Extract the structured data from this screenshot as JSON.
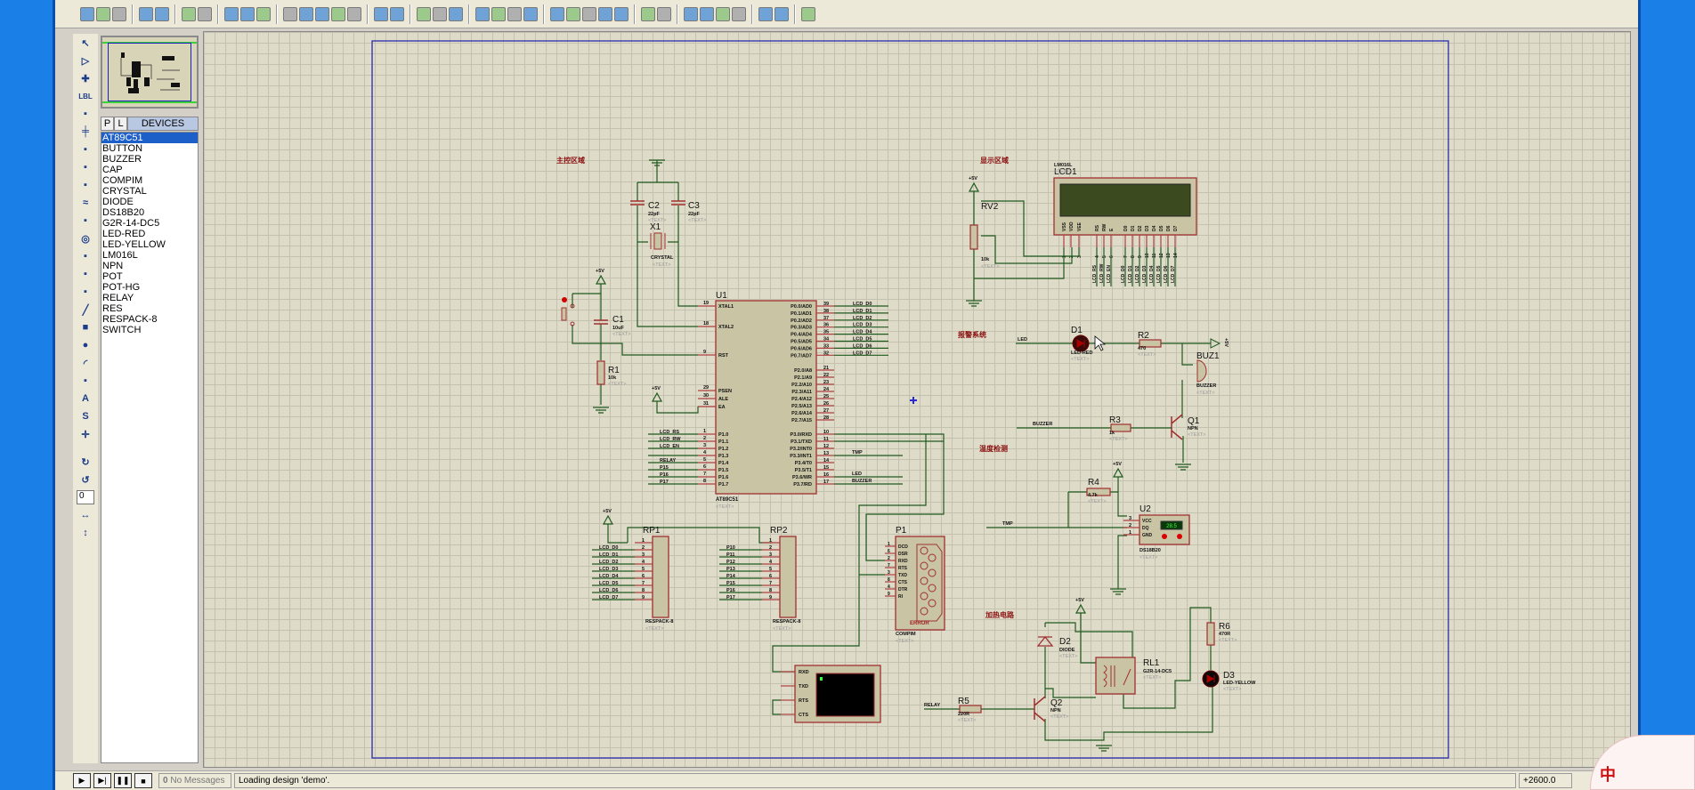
{
  "toolbar": {
    "icons": [
      "new-icon",
      "open-icon",
      "save-icon",
      "import-icon",
      "export-icon",
      "print-icon",
      "mark-area-icon",
      "refresh-icon",
      "grid-icon",
      "origin-icon",
      "pan-icon",
      "zoom-in-icon",
      "zoom-out-icon",
      "zoom-all-icon",
      "zoom-area-icon",
      "undo-icon",
      "redo-icon",
      "cut-icon",
      "copy-icon",
      "paste-icon",
      "block-copy-icon",
      "block-move-icon",
      "block-rotate-icon",
      "block-delete-icon",
      "pick-device-icon",
      "make-device-icon",
      "packaging-icon",
      "decompose-icon",
      "wire-autorouter-icon",
      "search-icon",
      "property-assign-icon",
      "new-sheet-icon",
      "add-sheet-icon",
      "remove-sheet-icon",
      "exit-to-parent-icon",
      "bill-of-materials-icon",
      "electrical-rule-check-icon",
      "ares-icon"
    ]
  },
  "tools": {
    "icons": [
      "selection-icon",
      "component-icon",
      "junction-icon",
      "wire-label-icon",
      "text-script-icon",
      "bus-icon",
      "subcircuit-icon",
      "terminal-icon",
      "device-pin-icon",
      "graph-icon",
      "tape-recorder-icon",
      "generator-icon",
      "voltage-probe-icon",
      "current-probe-icon",
      "virtual-instrument-icon",
      "line-icon",
      "box-icon",
      "circle-icon",
      "arc-icon",
      "path-icon",
      "text-icon",
      "symbol-icon",
      "marker-icon"
    ],
    "wire_label": "LBL",
    "rotation_value": "0"
  },
  "devices": {
    "tab_p": "P",
    "tab_l": "L",
    "title": "DEVICES",
    "items": [
      "AT89C51",
      "BUTTON",
      "BUZZER",
      "CAP",
      "COMPIM",
      "CRYSTAL",
      "DIODE",
      "DS18B20",
      "G2R-14-DC5",
      "LED-RED",
      "LED-YELLOW",
      "LM016L",
      "NPN",
      "POT",
      "POT-HG",
      "RELAY",
      "RES",
      "RESPACK-8",
      "SWITCH"
    ],
    "selected": "AT89C51"
  },
  "schematic": {
    "regions": [
      "主控区域",
      "显示区域",
      "报警系统",
      "温度检测",
      "加热电路"
    ],
    "text_placeholder": "<TEXT>",
    "power": "+5V",
    "components": {
      "U1": {
        "ref": "U1",
        "value": "AT89C51"
      },
      "C1": {
        "ref": "C1",
        "value": "10uF"
      },
      "C2": {
        "ref": "C2",
        "value": "22pF"
      },
      "C3": {
        "ref": "C3",
        "value": "22pF"
      },
      "X1": {
        "ref": "X1",
        "value": "CRYSTAL"
      },
      "R1": {
        "ref": "R1",
        "value": "10k"
      },
      "LCD1": {
        "ref": "LCD1",
        "value": "LM016L"
      },
      "RV2": {
        "ref": "RV2",
        "value": "10k"
      },
      "D1": {
        "ref": "D1",
        "value": "LED-RED"
      },
      "R2": {
        "ref": "R2",
        "value": "470"
      },
      "BUZ1": {
        "ref": "BUZ1",
        "value": "BUZZER"
      },
      "Q1": {
        "ref": "Q1",
        "value": "NPN"
      },
      "R3": {
        "ref": "R3",
        "value": "1k"
      },
      "R4": {
        "ref": "R4",
        "value": "4.7k"
      },
      "U2": {
        "ref": "U2",
        "value": "DS18B20",
        "display": "28.5"
      },
      "RP1": {
        "ref": "RP1",
        "value": "RESPACK-8"
      },
      "RP2": {
        "ref": "RP2",
        "value": "RESPACK-8"
      },
      "P1": {
        "ref": "P1",
        "value": "COMPIM",
        "error": "ERROR"
      },
      "D2": {
        "ref": "D2",
        "value": "DIODE"
      },
      "RL1": {
        "ref": "RL1",
        "value": "G2R-14-DC5"
      },
      "Q2": {
        "ref": "Q2",
        "value": "NPN"
      },
      "R5": {
        "ref": "R5",
        "value": "220R"
      },
      "R6": {
        "ref": "R6",
        "value": "470R"
      },
      "D3": {
        "ref": "D3",
        "value": "LED-YELLOW"
      }
    },
    "u1_left_pins": [
      {
        "num": "19",
        "name": "XTAL1"
      },
      {
        "num": "18",
        "name": "XTAL2"
      },
      {
        "num": "9",
        "name": "RST"
      },
      {
        "num": "29",
        "name": "PSEN"
      },
      {
        "num": "30",
        "name": "ALE"
      },
      {
        "num": "31",
        "name": "EA"
      },
      {
        "num": "1",
        "name": "P1.0"
      },
      {
        "num": "2",
        "name": "P1.1"
      },
      {
        "num": "3",
        "name": "P1.2"
      },
      {
        "num": "4",
        "name": "P1.3"
      },
      {
        "num": "5",
        "name": "P1.4"
      },
      {
        "num": "6",
        "name": "P1.5"
      },
      {
        "num": "7",
        "name": "P1.6"
      },
      {
        "num": "8",
        "name": "P1.7"
      }
    ],
    "u1_right_pins": [
      {
        "num": "39",
        "name": "P0.0/AD0"
      },
      {
        "num": "38",
        "name": "P0.1/AD1"
      },
      {
        "num": "37",
        "name": "P0.2/AD2"
      },
      {
        "num": "36",
        "name": "P0.3/AD3"
      },
      {
        "num": "35",
        "name": "P0.4/AD4"
      },
      {
        "num": "34",
        "name": "P0.5/AD5"
      },
      {
        "num": "33",
        "name": "P0.6/AD6"
      },
      {
        "num": "32",
        "name": "P0.7/AD7"
      },
      {
        "num": "21",
        "name": "P2.0/A8"
      },
      {
        "num": "22",
        "name": "P2.1/A9"
      },
      {
        "num": "23",
        "name": "P2.2/A10"
      },
      {
        "num": "24",
        "name": "P2.3/A11"
      },
      {
        "num": "25",
        "name": "P2.4/A12"
      },
      {
        "num": "26",
        "name": "P2.5/A13"
      },
      {
        "num": "27",
        "name": "P2.6/A14"
      },
      {
        "num": "28",
        "name": "P2.7/A15"
      },
      {
        "num": "10",
        "name": "P3.0/RXD"
      },
      {
        "num": "11",
        "name": "P3.1/TXD"
      },
      {
        "num": "12",
        "name": "P3.2/INT0"
      },
      {
        "num": "13",
        "name": "P3.3/INT1"
      },
      {
        "num": "14",
        "name": "P3.4/T0"
      },
      {
        "num": "15",
        "name": "P3.5/T1"
      },
      {
        "num": "16",
        "name": "P3.6/WR"
      },
      {
        "num": "17",
        "name": "P3.7/RD"
      }
    ],
    "p0_nets": [
      "LCD_D0",
      "LCD_D1",
      "LCD_D2",
      "LCD_D3",
      "LCD_D4",
      "LCD_D5",
      "LCD_D6",
      "LCD_D7"
    ],
    "p1_nets": [
      "LCD_RS",
      "LCD_RW",
      "LCD_EN",
      "",
      "RELAY",
      "P15",
      "P16",
      "P17"
    ],
    "p3_nets": {
      "tmp": "TMP",
      "led": "LED",
      "buzzer": "BUZZER"
    },
    "lcd_pins": [
      {
        "num": "1",
        "name": "VSS"
      },
      {
        "num": "2",
        "name": "VDD"
      },
      {
        "num": "3",
        "name": "VEE"
      },
      {
        "num": "4",
        "name": "RS",
        "net": "LCD_RS"
      },
      {
        "num": "5",
        "name": "RW",
        "net": "LCD_RW"
      },
      {
        "num": "6",
        "name": "E",
        "net": "LCD_EN"
      },
      {
        "num": "7",
        "name": "D0",
        "net": "LCD_D0"
      },
      {
        "num": "8",
        "name": "D1",
        "net": "LCD_D1"
      },
      {
        "num": "9",
        "name": "D2",
        "net": "LCD_D2"
      },
      {
        "num": "10",
        "name": "D3",
        "net": "LCD_D3"
      },
      {
        "num": "11",
        "name": "D4",
        "net": "LCD_D4"
      },
      {
        "num": "12",
        "name": "D5",
        "net": "LCD_D5"
      },
      {
        "num": "13",
        "name": "D6",
        "net": "LCD_D6"
      },
      {
        "num": "14",
        "name": "D7",
        "net": "LCD_D7"
      }
    ],
    "rp_pins": [
      "1",
      "2",
      "3",
      "4",
      "5",
      "6",
      "7",
      "8",
      "9"
    ],
    "rp1_nets": [
      "LCD_D0",
      "LCD_D1",
      "LCD_D2",
      "LCD_D3",
      "LCD_D4",
      "LCD_D5",
      "LCD_D6",
      "LCD_D7"
    ],
    "rp2_nets": [
      "P10",
      "P11",
      "P12",
      "P13",
      "P14",
      "P15",
      "P16",
      "P17"
    ],
    "p1_pins": [
      {
        "num": "1",
        "name": "DCD"
      },
      {
        "num": "6",
        "name": "DSR"
      },
      {
        "num": "2",
        "name": "RXD"
      },
      {
        "num": "7",
        "name": "RTS"
      },
      {
        "num": "3",
        "name": "TXD"
      },
      {
        "num": "8",
        "name": "CTS"
      },
      {
        "num": "4",
        "name": "DTR"
      },
      {
        "num": "9",
        "name": "RI"
      }
    ],
    "u2_pins": [
      {
        "num": "3",
        "name": "VCC"
      },
      {
        "num": "2",
        "name": "DQ"
      },
      {
        "num": "1",
        "name": "GND"
      }
    ],
    "terminal_pins": [
      "RXD",
      "TXD",
      "RTS",
      "CTS"
    ],
    "alarm_nets": {
      "led": "LED",
      "buzzer": "BUZZER",
      "tmp": "TMP",
      "relay": "RELAY"
    }
  },
  "status": {
    "messages": "No Messages",
    "message_count": "0",
    "text": "Loading design 'demo'.",
    "coords": "+2600.0"
  },
  "ime": {
    "label": "中"
  }
}
